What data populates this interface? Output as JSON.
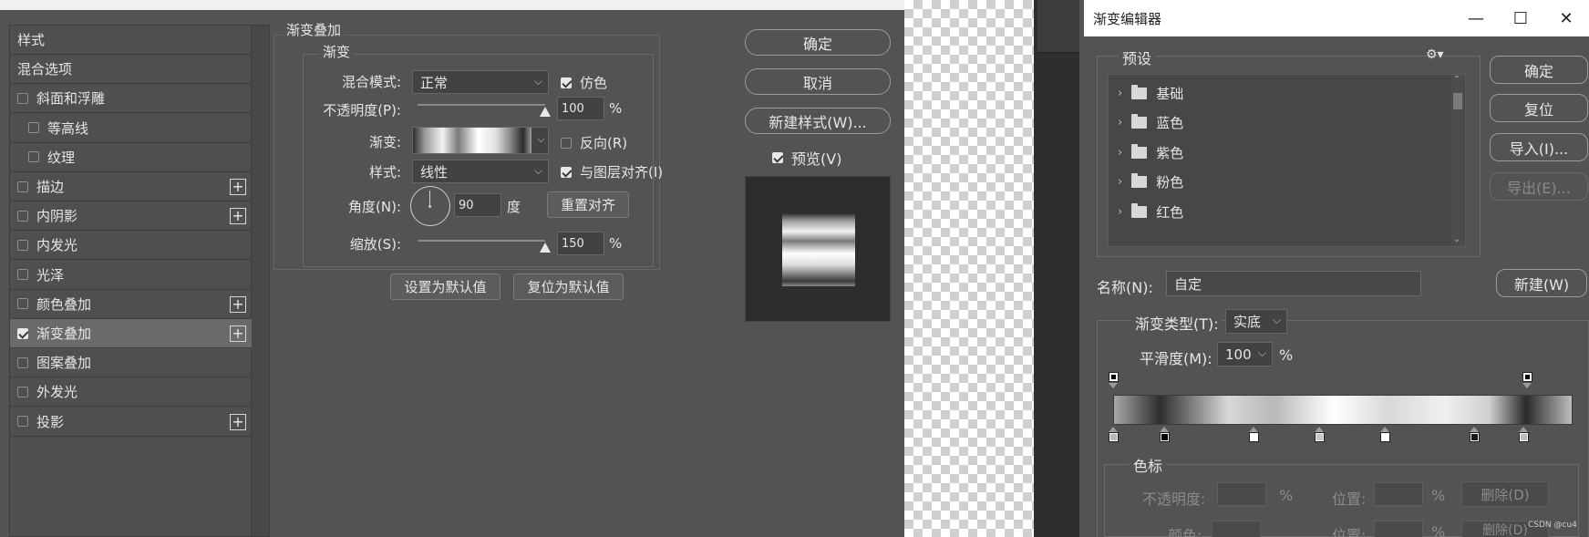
{
  "layer_style": {
    "list": {
      "items": [
        {
          "label": "样式",
          "checkbox": false,
          "plus": false,
          "indent": false,
          "checked": false,
          "selected": false
        },
        {
          "label": "混合选项",
          "checkbox": false,
          "plus": false,
          "indent": false,
          "checked": false,
          "selected": false
        },
        {
          "label": "斜面和浮雕",
          "checkbox": true,
          "plus": false,
          "indent": false,
          "checked": false,
          "selected": false
        },
        {
          "label": "等高线",
          "checkbox": true,
          "plus": false,
          "indent": true,
          "checked": false,
          "selected": false
        },
        {
          "label": "纹理",
          "checkbox": true,
          "plus": false,
          "indent": true,
          "checked": false,
          "selected": false
        },
        {
          "label": "描边",
          "checkbox": true,
          "plus": true,
          "indent": false,
          "checked": false,
          "selected": false
        },
        {
          "label": "内阴影",
          "checkbox": true,
          "plus": true,
          "indent": false,
          "checked": false,
          "selected": false
        },
        {
          "label": "内发光",
          "checkbox": true,
          "plus": false,
          "indent": false,
          "checked": false,
          "selected": false
        },
        {
          "label": "光泽",
          "checkbox": true,
          "plus": false,
          "indent": false,
          "checked": false,
          "selected": false
        },
        {
          "label": "颜色叠加",
          "checkbox": true,
          "plus": true,
          "indent": false,
          "checked": false,
          "selected": false
        },
        {
          "label": "渐变叠加",
          "checkbox": true,
          "plus": true,
          "indent": false,
          "checked": true,
          "selected": true
        },
        {
          "label": "图案叠加",
          "checkbox": true,
          "plus": false,
          "indent": false,
          "checked": false,
          "selected": false
        },
        {
          "label": "外发光",
          "checkbox": true,
          "plus": false,
          "indent": false,
          "checked": false,
          "selected": false
        },
        {
          "label": "投影",
          "checkbox": true,
          "plus": true,
          "indent": false,
          "checked": false,
          "selected": false
        }
      ],
      "plus_symbol": "+"
    },
    "section_title": "渐变叠加",
    "group_title": "渐变",
    "blend_mode_label": "混合模式:",
    "blend_mode_value": "正常",
    "dither_label": "仿色",
    "dither_checked": true,
    "opacity_label": "不透明度(P):",
    "opacity_value": "100",
    "opacity_percent": 100,
    "pct": "%",
    "gradient_label": "渐变:",
    "reverse_label": "反向(R)",
    "reverse_checked": false,
    "style_label": "样式:",
    "style_value": "线性",
    "align_label": "与图层对齐(I)",
    "align_checked": true,
    "angle_label": "角度(N):",
    "angle_value": "90",
    "angle_unit": "度",
    "reset_align_button": "重置对齐",
    "scale_label": "缩放(S):",
    "scale_value": "150",
    "scale_level": 1.0,
    "set_default_button": "设置为默认值",
    "reset_default_button": "复位为默认值",
    "ok_button": "确定",
    "cancel_button": "取消",
    "new_style_button": "新建样式(W)...",
    "preview_label": "预览(V)",
    "preview_checked": true
  },
  "gradient_editor": {
    "title": "渐变编辑器",
    "presets_label": "预设",
    "presets": [
      "基础",
      "蓝色",
      "紫色",
      "粉色",
      "红色"
    ],
    "ok_button": "确定",
    "reset_button": "复位",
    "import_button": "导入(I)...",
    "export_button": "导出(E)...",
    "name_label": "名称(N):",
    "name_value": "自定",
    "new_button": "新建(W)",
    "type_label": "渐变类型(T):",
    "type_value": "实底",
    "smoothness_label": "平滑度(M):",
    "smoothness_value": "100",
    "pct": "%",
    "stops_group": "色标",
    "opacity_label": "不透明度:",
    "location_label": "位置:",
    "delete_button": "删除(D)",
    "color_label": "颜色:",
    "location_label2": "位置:",
    "delete_button2": "删除(D)"
  },
  "watermark": "CSDN @cu4",
  "colors": {
    "panel_bg": "#535353",
    "list_selected": "#6a6a6a",
    "text": "#e6e6e6",
    "title_bar": "#ffffff"
  }
}
